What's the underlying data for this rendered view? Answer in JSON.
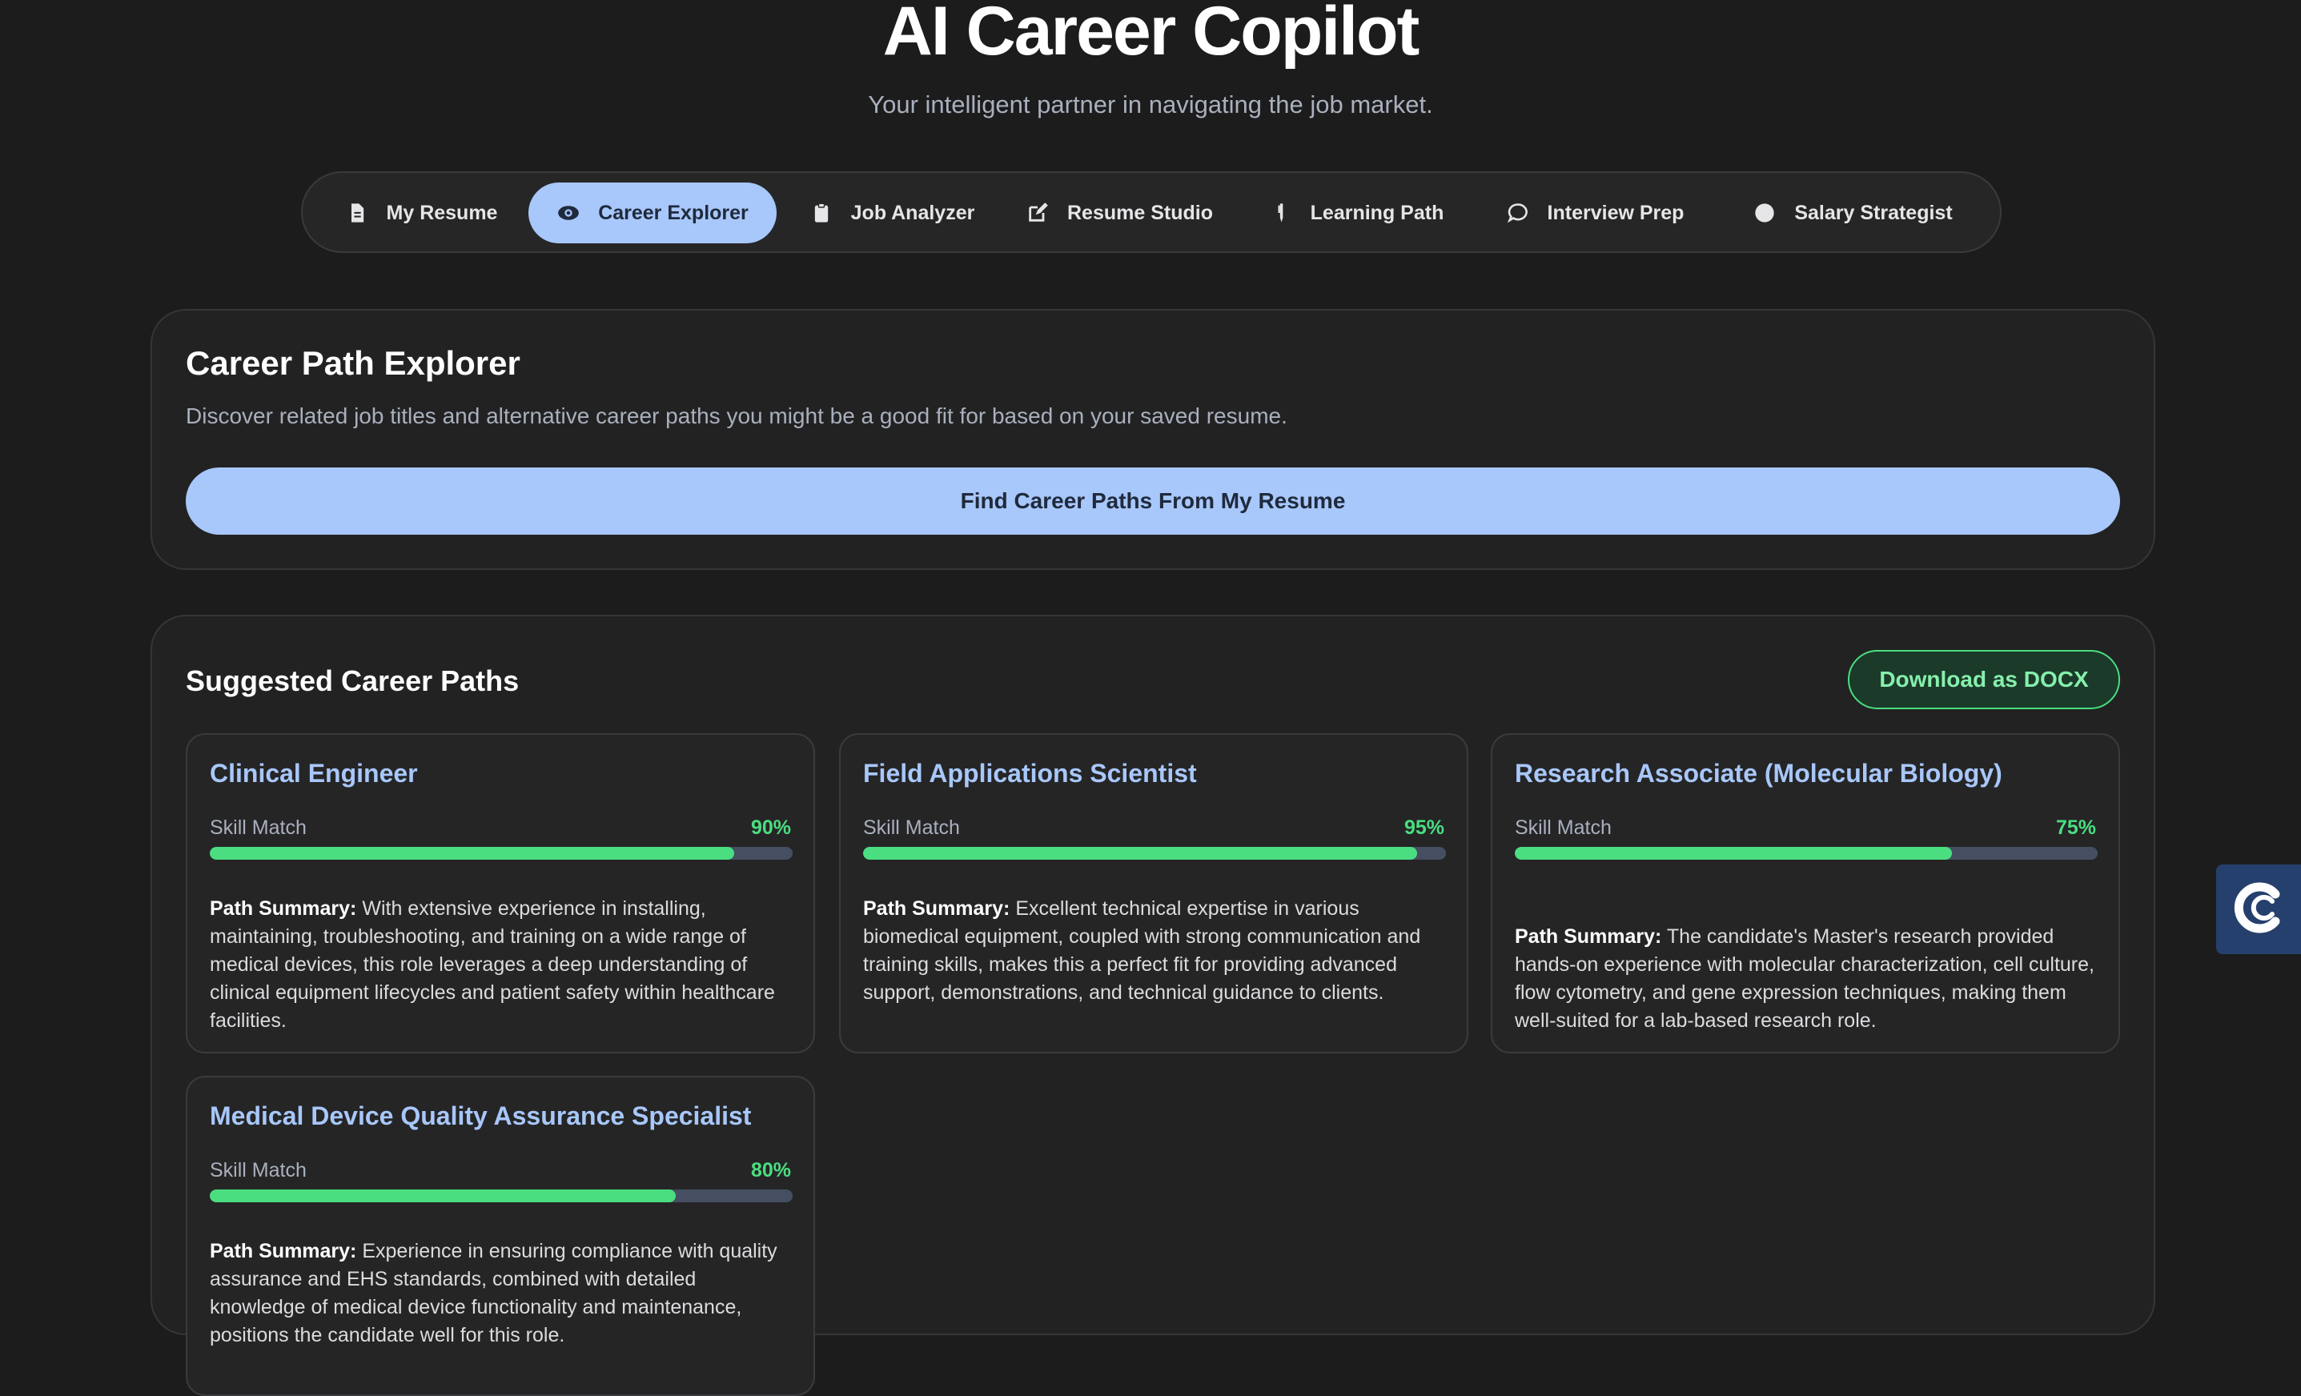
{
  "header": {
    "title": "AI Career Copilot",
    "subtitle": "Your intelligent partner in navigating the job market."
  },
  "nav": {
    "tabs": [
      {
        "label": "My Resume",
        "icon": "document-icon"
      },
      {
        "label": "Career Explorer",
        "icon": "eye-icon",
        "active": true
      },
      {
        "label": "Job Analyzer",
        "icon": "clipboard-icon"
      },
      {
        "label": "Resume Studio",
        "icon": "edit-icon"
      },
      {
        "label": "Learning Path",
        "icon": "pencil-icon"
      },
      {
        "label": "Interview Prep",
        "icon": "chat-bubble-icon"
      },
      {
        "label": "Salary Strategist",
        "icon": "dot-icon"
      }
    ]
  },
  "explorer": {
    "title": "Career Path Explorer",
    "description": "Discover related job titles and alternative career paths you might be a good fit for based on your saved resume.",
    "button_label": "Find Career Paths From My Resume"
  },
  "suggested": {
    "title": "Suggested Career Paths",
    "download_label": "Download as DOCX",
    "skill_label": "Skill Match",
    "summary_label": "Path Summary:",
    "paths": [
      {
        "title": "Clinical Engineer",
        "match": "90%",
        "match_value": 90,
        "summary": "With extensive experience in installing, maintaining, troubleshooting, and training on a wide range of medical devices, this role leverages a deep understanding of clinical equipment lifecycles and patient safety within healthcare facilities."
      },
      {
        "title": "Field Applications Scientist",
        "match": "95%",
        "match_value": 95,
        "summary": "Excellent technical expertise in various biomedical equipment, coupled with strong communication and training skills, makes this a perfect fit for providing advanced support, demonstrations, and technical guidance to clients."
      },
      {
        "title": "Research Associate (Molecular Biology)",
        "match": "75%",
        "match_value": 75,
        "summary": "The candidate's Master's research provided hands-on experience with molecular characterization, cell culture, flow cytometry, and gene expression techniques, making them well-suited for a lab-based research role."
      },
      {
        "title": "Medical Device Quality Assurance Specialist",
        "match": "80%",
        "match_value": 80,
        "summary": "Experience in ensuring compliance with quality assurance and EHS standards, combined with detailed knowledge of medical device functionality and maintenance, positions the candidate well for this role."
      }
    ]
  },
  "widget": {
    "icon": "chat-widget-icon"
  },
  "colors": {
    "accent": "#a8c7fa",
    "success": "#4ade80",
    "background": "#1c1c1d"
  }
}
